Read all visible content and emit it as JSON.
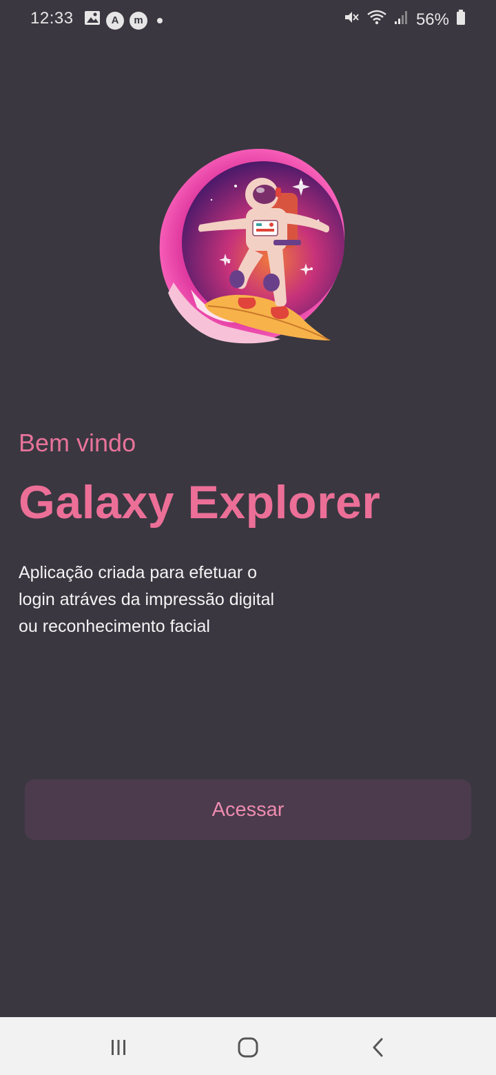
{
  "status_bar": {
    "time": "12:33",
    "battery": "56%",
    "icons_left": [
      "image-icon",
      "a-circle-icon",
      "m-circle-icon",
      "dot-icon"
    ],
    "icons_right": [
      "mute-icon",
      "wifi-icon",
      "signal-icon",
      "battery-icon"
    ]
  },
  "hero": {
    "image": "astronaut-surfing-illustration"
  },
  "welcome": "Bem vindo",
  "app_title": "Galaxy Explorer",
  "description": {
    "line1": "Aplicação criada para efetuar o",
    "line2": "login atráves da impressão digital",
    "line3": "ou reconhecimento facial"
  },
  "button": {
    "label": "Acessar"
  },
  "colors": {
    "background": "#3a3740",
    "accent": "#ec6f98",
    "button_bg": "#4b3b4c",
    "button_text": "#ee8bb0"
  },
  "nav": {
    "buttons": [
      "recent-apps-icon",
      "home-icon",
      "back-icon"
    ]
  }
}
